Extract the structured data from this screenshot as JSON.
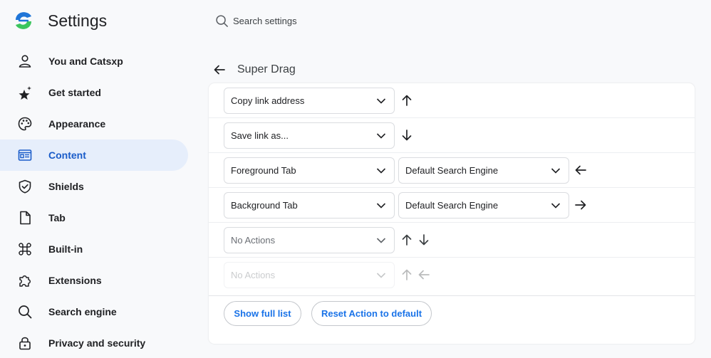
{
  "header": {
    "app_title": "Settings",
    "search_placeholder": "Search settings"
  },
  "sidebar": {
    "items": [
      {
        "label": "You and Catsxp",
        "icon": "person-icon",
        "active": false
      },
      {
        "label": "Get started",
        "icon": "sparkle-star-icon",
        "active": false
      },
      {
        "label": "Appearance",
        "icon": "palette-icon",
        "active": false
      },
      {
        "label": "Content",
        "icon": "content-layout-icon",
        "active": true
      },
      {
        "label": "Shields",
        "icon": "shield-icon",
        "active": false
      },
      {
        "label": "Tab",
        "icon": "tab-page-icon",
        "active": false
      },
      {
        "label": "Built-in",
        "icon": "command-key-icon",
        "active": false
      },
      {
        "label": "Extensions",
        "icon": "puzzle-piece-icon",
        "active": false
      },
      {
        "label": "Search engine",
        "icon": "search-icon",
        "active": false
      },
      {
        "label": "Privacy and security",
        "icon": "lock-icon",
        "active": false
      }
    ]
  },
  "main": {
    "page_title": "Super Drag",
    "rows": [
      {
        "action": "Copy link address",
        "engine": null,
        "directions": [
          "up"
        ]
      },
      {
        "action": "Save link as...",
        "engine": null,
        "directions": [
          "down"
        ]
      },
      {
        "action": "Foreground Tab",
        "engine": "Default Search Engine",
        "directions": [
          "left"
        ]
      },
      {
        "action": "Background Tab",
        "engine": "Default Search Engine",
        "directions": [
          "right"
        ]
      },
      {
        "action": "No Actions",
        "engine": null,
        "directions": [
          "up",
          "down"
        ]
      },
      {
        "action": "No Actions",
        "engine": null,
        "directions": [
          "up",
          "left"
        ]
      }
    ],
    "buttons": {
      "show_full_list": "Show full list",
      "reset_action": "Reset Action to default"
    }
  },
  "colors": {
    "accent": "#1a73e8",
    "active_nav_bg": "#e6eefb",
    "active_nav_text": "#1a5cc9",
    "logo_blue": "#1f75d8",
    "logo_green": "#3cc55e"
  }
}
